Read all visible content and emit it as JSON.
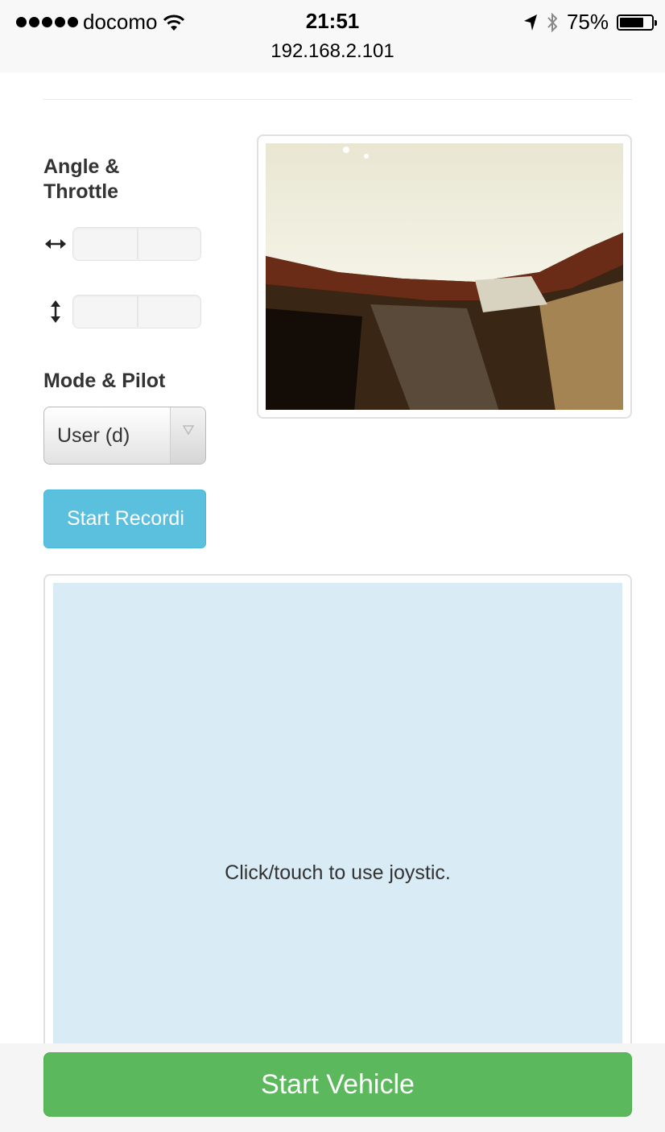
{
  "status_bar": {
    "carrier": "docomo",
    "time": "21:51",
    "url": "192.168.2.101",
    "battery": "75%",
    "battery_level": 0.75
  },
  "controls": {
    "angle_throttle_title": "Angle &\nThrottle",
    "angle_icon": "horizontal-arrows-icon",
    "throttle_icon": "vertical-arrows-icon",
    "mode_pilot_title": "Mode & Pilot",
    "mode_select_value": "User (d)",
    "record_button": "Start Recordi"
  },
  "camera": {
    "image": "camera-feed-image"
  },
  "joystick": {
    "hint": "Click/touch to use joystic."
  },
  "footer": {
    "start_button": "Start Vehicle"
  },
  "colors": {
    "info": "#5bc0de",
    "success": "#5cb85c",
    "joystick_bg": "#d9ebf4"
  }
}
